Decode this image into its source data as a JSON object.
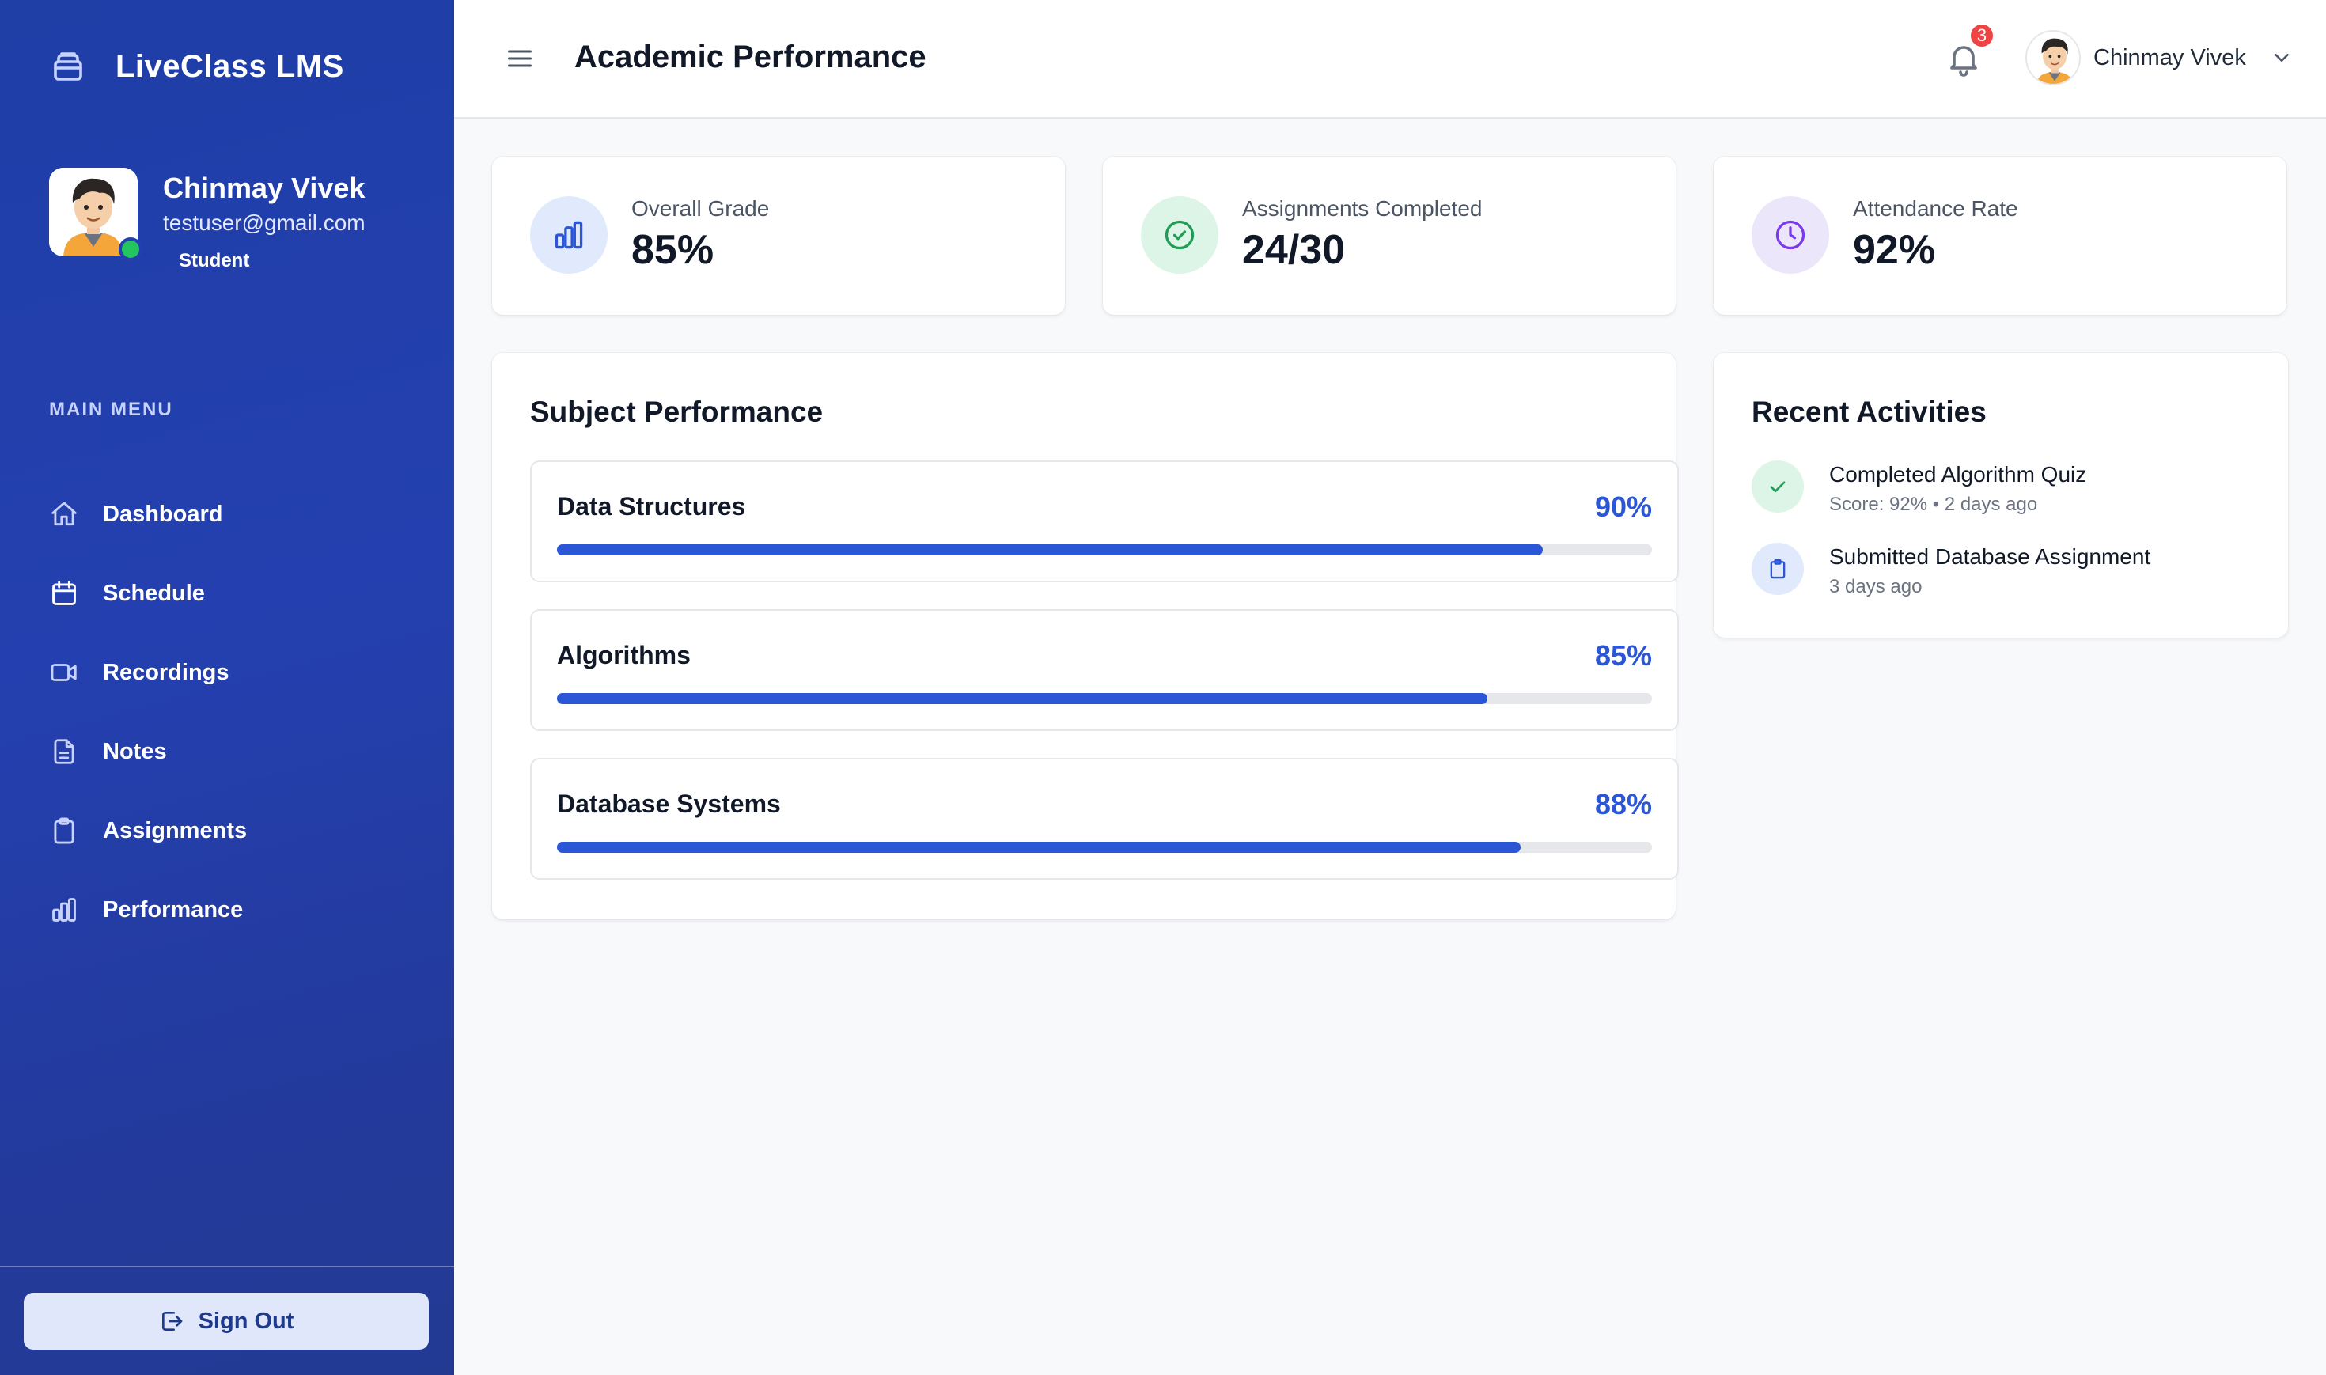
{
  "app": {
    "name": "LiveClass LMS"
  },
  "profile": {
    "name": "Chinmay Vivek",
    "email": "testuser@gmail.com",
    "role": "Student"
  },
  "sidebar": {
    "menu_title": "MAIN MENU",
    "items": [
      {
        "label": "Dashboard",
        "icon": "home-icon"
      },
      {
        "label": "Schedule",
        "icon": "calendar-icon"
      },
      {
        "label": "Recordings",
        "icon": "video-icon"
      },
      {
        "label": "Notes",
        "icon": "document-icon"
      },
      {
        "label": "Assignments",
        "icon": "clipboard-icon"
      },
      {
        "label": "Performance",
        "icon": "bar-chart-icon"
      }
    ],
    "sign_out": "Sign Out"
  },
  "header": {
    "title": "Academic Performance",
    "notification_count": "3",
    "user_name": "Chinmay Vivek"
  },
  "stats": [
    {
      "label": "Overall Grade",
      "value": "85%",
      "icon": "bar-chart-icon",
      "bg": "#e0eafc",
      "color": "#2b56d6"
    },
    {
      "label": "Assignments Completed",
      "value": "24/30",
      "icon": "check-circle-icon",
      "bg": "#dcf5e6",
      "color": "#1f9d55"
    },
    {
      "label": "Attendance Rate",
      "value": "92%",
      "icon": "clock-icon",
      "bg": "#ece6fb",
      "color": "#7c3aed"
    }
  ],
  "subject_performance": {
    "title": "Subject Performance",
    "subjects": [
      {
        "name": "Data Structures",
        "percent_label": "90%",
        "progress": 0.9
      },
      {
        "name": "Algorithms",
        "percent_label": "85%",
        "progress": 0.85
      },
      {
        "name": "Database Systems",
        "percent_label": "88%",
        "progress": 0.88
      }
    ]
  },
  "recent_activities": {
    "title": "Recent Activities",
    "items": [
      {
        "title": "Completed Algorithm Quiz",
        "subtitle": "Score: 92% • 2 days ago",
        "icon": "check-icon"
      },
      {
        "title": "Submitted Database Assignment",
        "subtitle": "3 days ago",
        "icon": "clipboard-icon"
      }
    ]
  },
  "colors": {
    "accent": "#2b56d6",
    "sidebar": "#2440b0",
    "danger": "#ef4444",
    "success": "#22c55e"
  }
}
